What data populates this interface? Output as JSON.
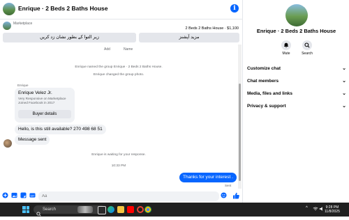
{
  "header": {
    "title": "Enrique · 2 Beds 2 Baths House",
    "info_icon": "i"
  },
  "marketplace": {
    "label": "Marketplace",
    "listing": "2 Beds 2 Baths House · $1,100",
    "button_left": "زیر التوا کے بطور نشان زد کریں",
    "button_right": "مزید آپشنز"
  },
  "thread": {
    "add_label": "Add",
    "name_label": "Name",
    "event1": "Enrique named the group Enrique · 2 Beds 2 Baths House.",
    "event2": "Enrique changed the group photo.",
    "sender_name": "Enrique",
    "card": {
      "name": "Enrique Velez Jr.",
      "line1": "Very Responsive on Marketplace",
      "line2": "Joined Facebook in 2017",
      "button": "Buyer details"
    },
    "message1": "Hello, is this still available? 270 498 68 51",
    "message2": "Message sent",
    "waiting": "Enrique is waiting for your response.",
    "time": "10:33 PM",
    "outgoing": "Thanks for your interest .",
    "status": "Sent"
  },
  "composer": {
    "placeholder": "Aa"
  },
  "panel": {
    "title": "Enrique · 2 Beds 2 Baths House",
    "mute_label": "Mute",
    "search_label": "Search",
    "rows": [
      "Customize chat",
      "Chat members",
      "Media, files and links",
      "Privacy & support"
    ]
  },
  "taskbar": {
    "search_placeholder": "Search",
    "time": "9:28 PM",
    "date": "11/8/2025"
  },
  "colors": {
    "accent": "#0866ff",
    "bubble_in": "#f0f2f5",
    "taskbar": "#202020"
  }
}
